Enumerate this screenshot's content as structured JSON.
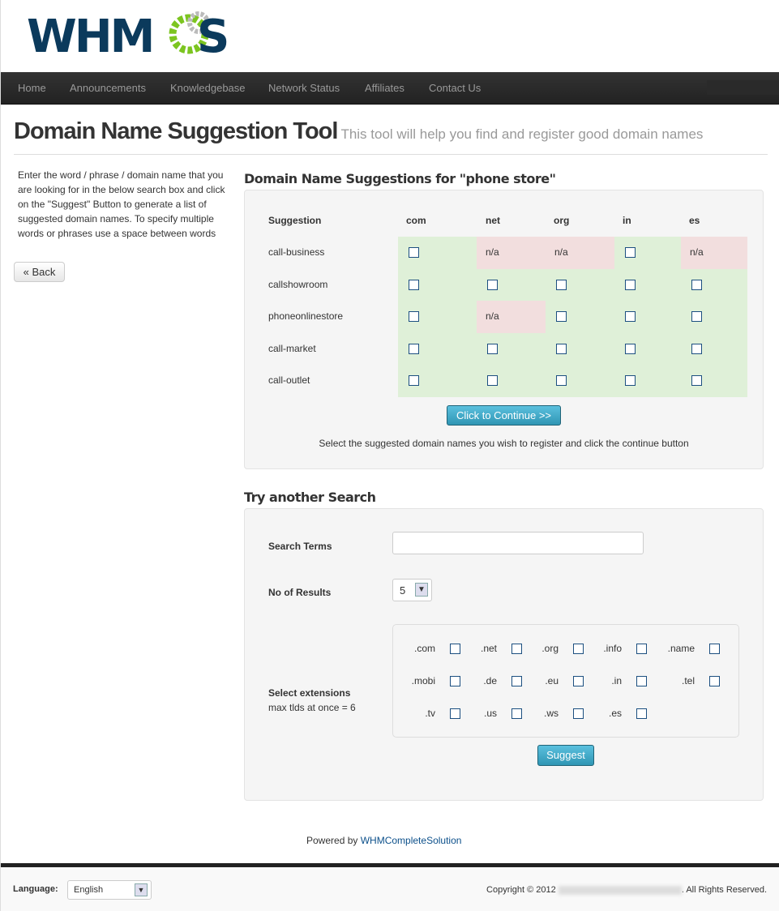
{
  "logo_text": "WHMCS",
  "nav": [
    "Home",
    "Announcements",
    "Knowledgebase",
    "Network Status",
    "Affiliates",
    "Contact Us"
  ],
  "page": {
    "title": "Domain Name Suggestion Tool",
    "subtitle": "This tool will help you find and register good domain names"
  },
  "intro": "Enter the word / phrase / domain name that you are looking for in the below search box and click on the \"Suggest\" Button to generate a list of suggested domain names. To specify multiple words or phrases use a space between words",
  "back_label": "« Back",
  "results": {
    "title": "Domain Name Suggestions for \"phone store\"",
    "columns": [
      "Suggestion",
      "com",
      "net",
      "org",
      "in",
      "es"
    ],
    "rows": [
      {
        "name": "call-business",
        "cells": [
          "available",
          "n/a",
          "n/a",
          "available",
          "n/a"
        ]
      },
      {
        "name": "callshowroom",
        "cells": [
          "available",
          "available",
          "available",
          "available",
          "available"
        ]
      },
      {
        "name": "phoneonlinestore",
        "cells": [
          "available",
          "n/a",
          "available",
          "available",
          "available"
        ]
      },
      {
        "name": "call-market",
        "cells": [
          "available",
          "available",
          "available",
          "available",
          "available"
        ]
      },
      {
        "name": "call-outlet",
        "cells": [
          "available",
          "available",
          "available",
          "available",
          "available"
        ]
      }
    ],
    "na_text": "n/a",
    "continue_label": "Click to Continue >>",
    "note": "Select the suggested domain names you wish to register and click the continue button",
    "colors": {
      "available": "#dff0d8",
      "unavailable": "#f2dede"
    }
  },
  "search": {
    "title": "Try another Search",
    "terms_label": "Search Terms",
    "terms_value": "",
    "results_label": "No of Results",
    "results_value": "5",
    "ext_label": "Select extensions",
    "ext_note": "max tlds at once = 6",
    "extensions": [
      ".com",
      ".net",
      ".org",
      ".info",
      ".name",
      ".mobi",
      ".de",
      ".eu",
      ".in",
      ".tel",
      ".tv",
      ".us",
      ".ws",
      ".es"
    ],
    "suggest_label": "Suggest"
  },
  "powered": {
    "prefix": "Powered by",
    "link": "WHMCompleteSolution"
  },
  "footer": {
    "language_label": "Language:",
    "language_value": "English",
    "copyright_prefix": "Copyright © 2012",
    "copyright_suffix": ". All Rights Reserved."
  }
}
